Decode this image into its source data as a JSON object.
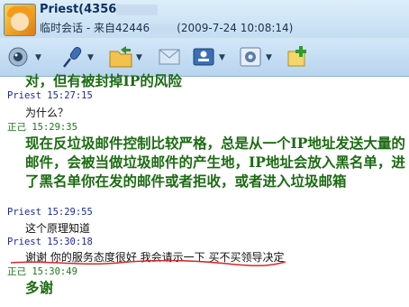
{
  "header": {
    "name": "Priest(4356",
    "subtitle_prefix": "临时会话 - 来自42446",
    "subtitle_time": "(2009-7-24 10:08:14)"
  },
  "toolbar": [
    {
      "icon": "camera-icon"
    },
    {
      "icon": "microphone-icon"
    },
    {
      "icon": "folder-send-icon"
    },
    {
      "icon": "mail-icon"
    },
    {
      "icon": "user-card-icon"
    },
    {
      "icon": "settings-icon"
    },
    {
      "icon": "add-app-icon"
    }
  ],
  "messages": [
    {
      "type": "big",
      "text": "对，但有被封掉IP的风险"
    },
    {
      "type": "head",
      "cls": "peer",
      "text": "Priest  15:27:15"
    },
    {
      "type": "msg",
      "text": "为什么？"
    },
    {
      "type": "head",
      "cls": "self",
      "text": "正己  15:29:35"
    },
    {
      "type": "big",
      "text": "现在反垃圾邮件控制比较严格，总是从一个IP地址发送大量的邮件，会被当做垃圾邮件的产生地，IP地址会放入黑名单，进了黑名单你在发的邮件或者拒收，或者进入垃圾邮箱"
    },
    {
      "type": "head",
      "cls": "peer",
      "text": "Priest  15:29:55"
    },
    {
      "type": "msg",
      "text": "这个原理知道"
    },
    {
      "type": "head",
      "cls": "peer",
      "text": "Priest  15:30:18"
    },
    {
      "type": "msg",
      "text": "谢谢 你的服务态度很好 我会请示一下 买不买领导决定"
    },
    {
      "type": "head",
      "cls": "self",
      "text": "正己  15:30:49"
    },
    {
      "type": "big",
      "text": "多谢"
    }
  ]
}
